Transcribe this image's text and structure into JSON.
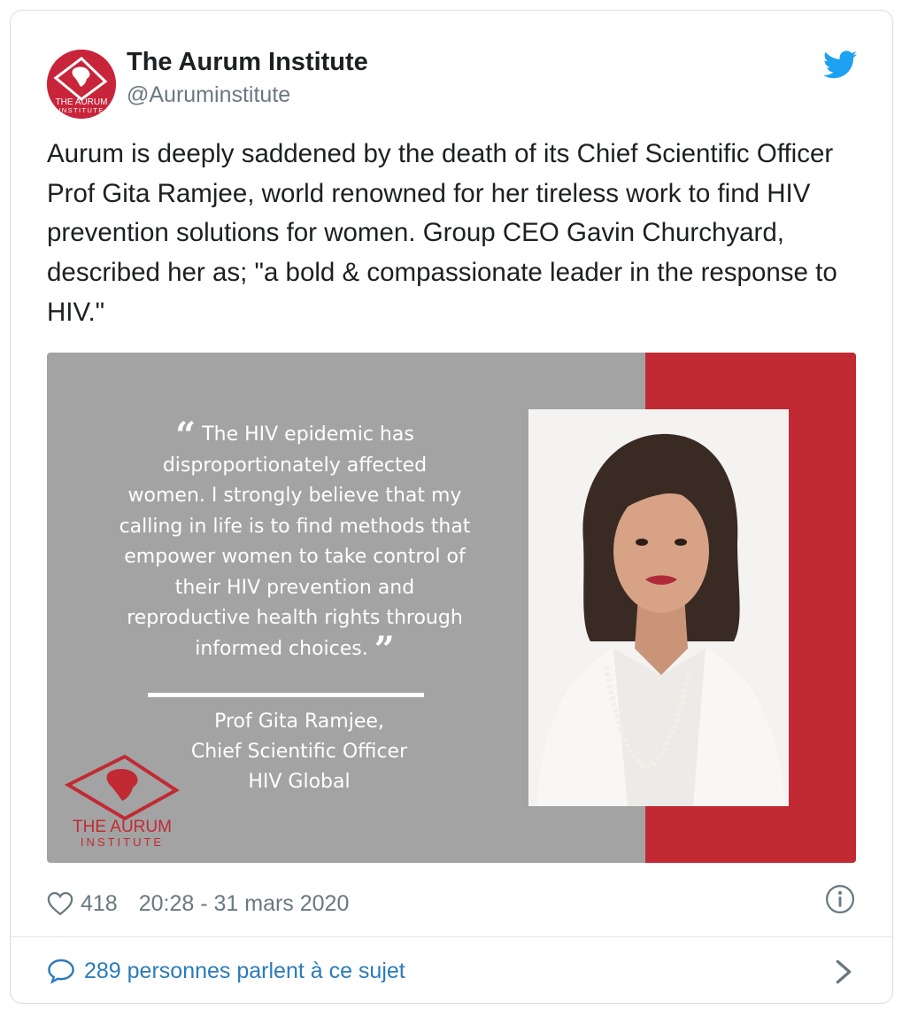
{
  "tweet": {
    "author_name": "The Aurum Institute",
    "author_handle": "@Auruminstitute",
    "avatar_logo_line1": "THE AURUM",
    "avatar_logo_line2": "INSTITUTE",
    "text": "Aurum is deeply saddened by the death of its Chief Scientific Officer Prof Gita Ramjee, world renowned for her tireless work to find HIV prevention solutions for women. Group CEO Gavin Churchyard, described her as; \"a bold & compassionate leader in the response to HIV.\"",
    "likes": "418",
    "timestamp": "20:28 - 31 mars 2020",
    "conversation_label": "289 personnes parlent à ce sujet"
  },
  "media": {
    "quote_lines": [
      "The HIV epidemic has",
      "disproportionately affected",
      "women. I strongly believe that my",
      "calling in life is to find methods that",
      "empower women to take control of",
      "their HIV prevention and",
      "reproductive health rights through",
      "informed choices."
    ],
    "attribution_lines": [
      "Prof Gita Ramjee,",
      "Chief Scientific Officer",
      "HIV Global"
    ],
    "logo_line1": "THE AURUM",
    "logo_line2": "INSTITUTE"
  },
  "icons": {
    "brand": "twitter-bird-icon",
    "like": "heart-icon",
    "info": "info-icon",
    "conversation": "speech-bubble-icon",
    "more": "chevron-right-icon"
  },
  "colors": {
    "twitter_blue": "#1da1f2",
    "link_blue": "#2b7bb9",
    "aurum_red": "#c12a33",
    "media_gray": "#a3a3a3",
    "meta_gray": "#697882"
  }
}
